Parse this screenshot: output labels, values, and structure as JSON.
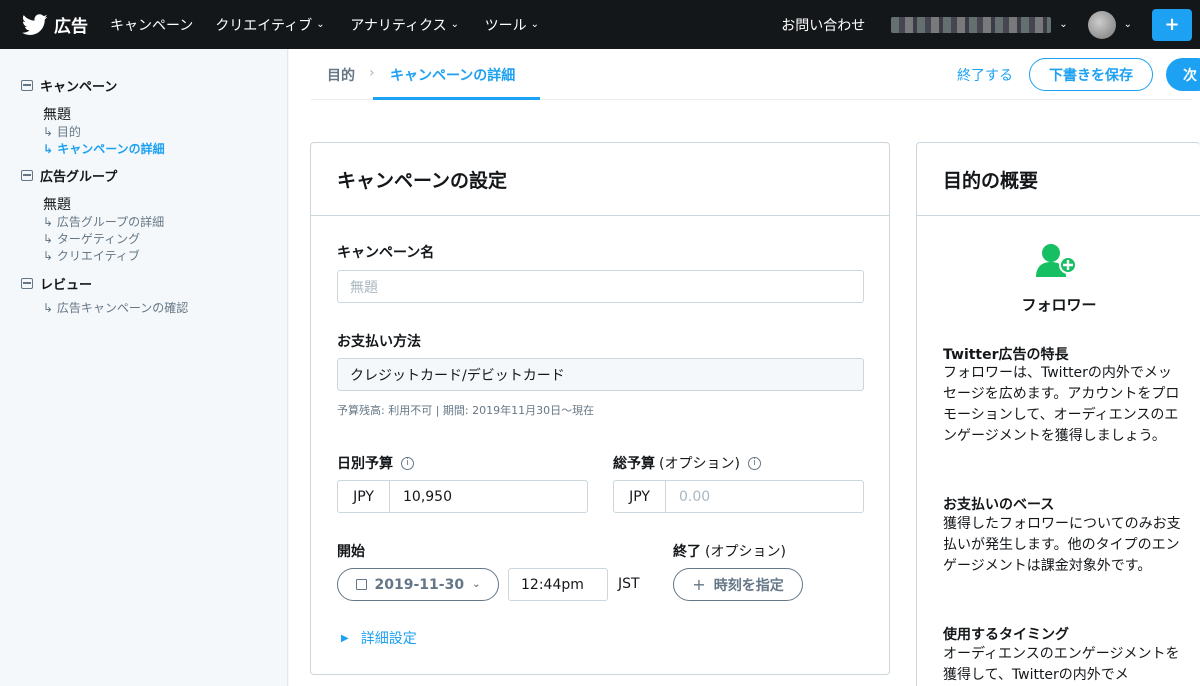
{
  "topbar": {
    "brand": "広告",
    "nav": [
      {
        "label": "キャンペーン",
        "has_menu": false
      },
      {
        "label": "クリエイティブ",
        "has_menu": true
      },
      {
        "label": "アナリティクス",
        "has_menu": true
      },
      {
        "label": "ツール",
        "has_menu": true
      }
    ],
    "contact": "お問い合わせ"
  },
  "sidebar": {
    "sections": [
      {
        "label": "キャンペーン",
        "title": "無題",
        "items": [
          {
            "label": "↳ 目的",
            "active": false
          },
          {
            "label": "↳ キャンペーンの詳細",
            "active": true
          }
        ]
      },
      {
        "label": "広告グループ",
        "title": "無題",
        "items": [
          {
            "label": "↳ 広告グループの詳細",
            "active": false
          },
          {
            "label": "↳ ターゲティング",
            "active": false
          },
          {
            "label": "↳ クリエイティブ",
            "active": false
          }
        ]
      },
      {
        "label": "レビュー",
        "title": "",
        "items": [
          {
            "label": "↳ 広告キャンペーンの確認",
            "active": false
          }
        ]
      }
    ]
  },
  "steps": {
    "step1": "目的",
    "step2": "キャンペーンの詳細",
    "end": "終了する",
    "save_draft": "下書きを保存",
    "next": "次"
  },
  "settings": {
    "title": "キャンペーンの設定",
    "name_label": "キャンペーン名",
    "name_placeholder": "無題",
    "payment_label": "お支払い方法",
    "payment_value": "クレジットカード/デビットカード",
    "payment_hint": "予算残高: 利用不可 | 期間: 2019年11月30日〜現在",
    "daily_label": "日別予算",
    "daily_currency": "JPY",
    "daily_value": "10,950",
    "total_label": "総予算",
    "total_optional": "(オプション)",
    "total_currency": "JPY",
    "total_placeholder": "0.00",
    "start_label": "開始",
    "start_date": "2019-11-30",
    "start_time": "12:44pm",
    "timezone": "JST",
    "end_label": "終了",
    "end_optional": "(オプション)",
    "set_time": "時刻を指定",
    "advanced": "詳細設定"
  },
  "summary": {
    "title": "目的の概要",
    "objective": "フォロワー",
    "icon": "user-add-icon",
    "accent": "#17bf63",
    "sections": [
      {
        "heading": "Twitter広告の特長",
        "body": "フォロワーは、Twitterの内外でメッセージを広めます。アカウントをプロモーションして、オーディエンスのエンゲージメントを獲得しましょう。"
      },
      {
        "heading": "お支払いのベース",
        "body": "獲得したフォロワーについてのみお支払いが発生します。他のタイプのエンゲージメントは課金対象外です。"
      },
      {
        "heading": "使用するタイミング",
        "body": "オーディエンスのエンゲージメントを獲得して、Twitterの内外でメ"
      }
    ]
  },
  "colors": {
    "brand": "#1da1f2",
    "topbar": "#14171a",
    "success": "#17bf63"
  }
}
